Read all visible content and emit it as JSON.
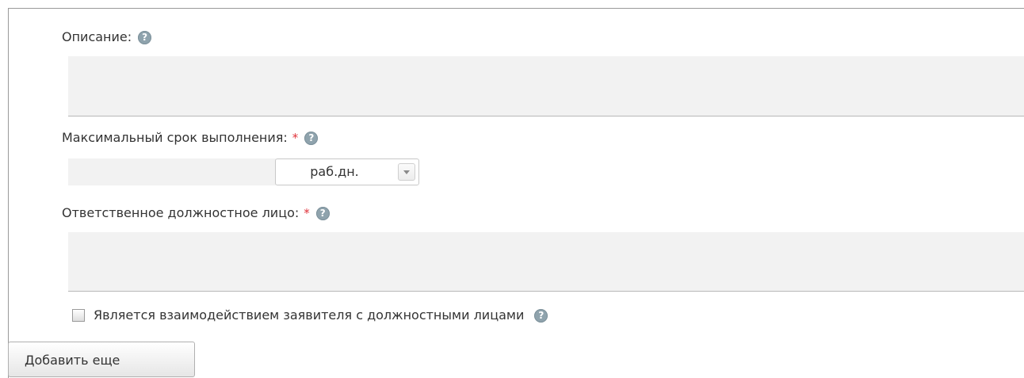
{
  "form": {
    "description": {
      "label": "Описание:",
      "help_icon": "question-circle-icon",
      "value": ""
    },
    "max_term": {
      "label": "Максимальный срок выполнения:",
      "required_mark": "*",
      "help_icon": "question-circle-icon",
      "value": "",
      "unit_selected": "раб.дн."
    },
    "responsible": {
      "label": "Ответственное должностное лицо:",
      "required_mark": "*",
      "help_icon": "question-circle-icon",
      "value": ""
    },
    "interaction_checkbox": {
      "label": "Является взаимодействием заявителя с должностными лицами",
      "checked": false,
      "help_icon": "question-circle-icon"
    },
    "add_more_button": "Добавить еще"
  },
  "colors": {
    "required": "#e0323a",
    "help_icon": "#8fa3ad",
    "field_background": "#f2f2f2"
  }
}
